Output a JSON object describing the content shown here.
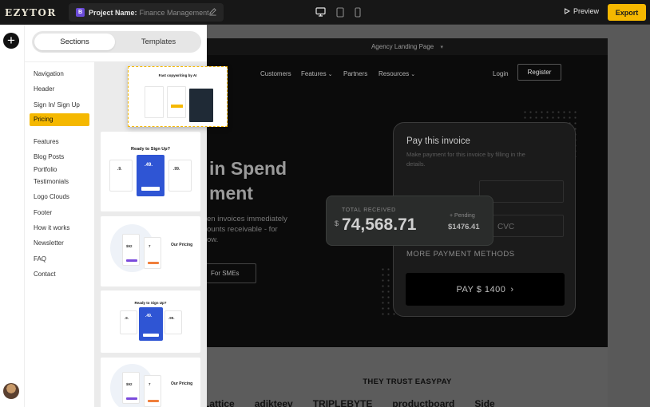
{
  "app": {
    "logo": "EZYTOR",
    "project_badge": "B",
    "project_label": "Project Name:",
    "project_value": "Finance Management",
    "preview_label": "Preview",
    "export_label": "Export",
    "accent_color": "#f5b800"
  },
  "sidebar": {
    "tabs": [
      "Sections",
      "Templates"
    ],
    "categories": [
      "Navigation",
      "Header",
      "Sign In/ Sign Up",
      "Pricing",
      "Features",
      "Blog Posts",
      "Portfolio",
      "Testimonials",
      "Logo Clouds",
      "Footer",
      "How it works",
      "Newsletter",
      "FAQ",
      "Contact"
    ],
    "active_category": "Pricing"
  },
  "thumbnails": {
    "drag_title": "Fast copywriting by AI",
    "t1_title": "Ready to Sign Up?",
    "t1_prices": [
      ".9.",
      ".49.",
      ".99."
    ],
    "t2_title": "Our Pricing",
    "t2_prices": [
      "$92",
      "7"
    ],
    "t3_title": "Ready to Sign Up?",
    "t3_prices": [
      ".9.",
      ".49.",
      ".99."
    ],
    "t4_title": "Our Pricing",
    "t4_prices": [
      "$92",
      "7"
    ]
  },
  "canvas": {
    "page_title": "Agency Landing Page",
    "nav": [
      "Customers",
      "Features",
      "Partners",
      "Resources"
    ],
    "login": "Login",
    "register": "Register",
    "hero_line1": "in Spend",
    "hero_line2": "ment",
    "sub_line1": "en invoices immediately",
    "sub_line2": "ounts receivable - for",
    "sub_line3": "ow.",
    "cta": "For SMEs",
    "invoice_title": "Pay this invoice",
    "invoice_sub": "Make payment for this invoice by filling in the details.",
    "cvc": "CVC",
    "more_methods": "MORE PAYMENT METHODS",
    "pay_button": "PAY $ 1400",
    "total_label": "TOTAL RECEIVED",
    "currency": "$",
    "total_amount": "74,568.71",
    "pending_label": "+ Pending",
    "pending_amount": "$1476.41",
    "trust_title": "THEY TRUST EASYPAY",
    "logos": [
      "Lattice",
      "adikteev",
      "TRIPLEBYTE",
      "productboard",
      "Side"
    ]
  }
}
